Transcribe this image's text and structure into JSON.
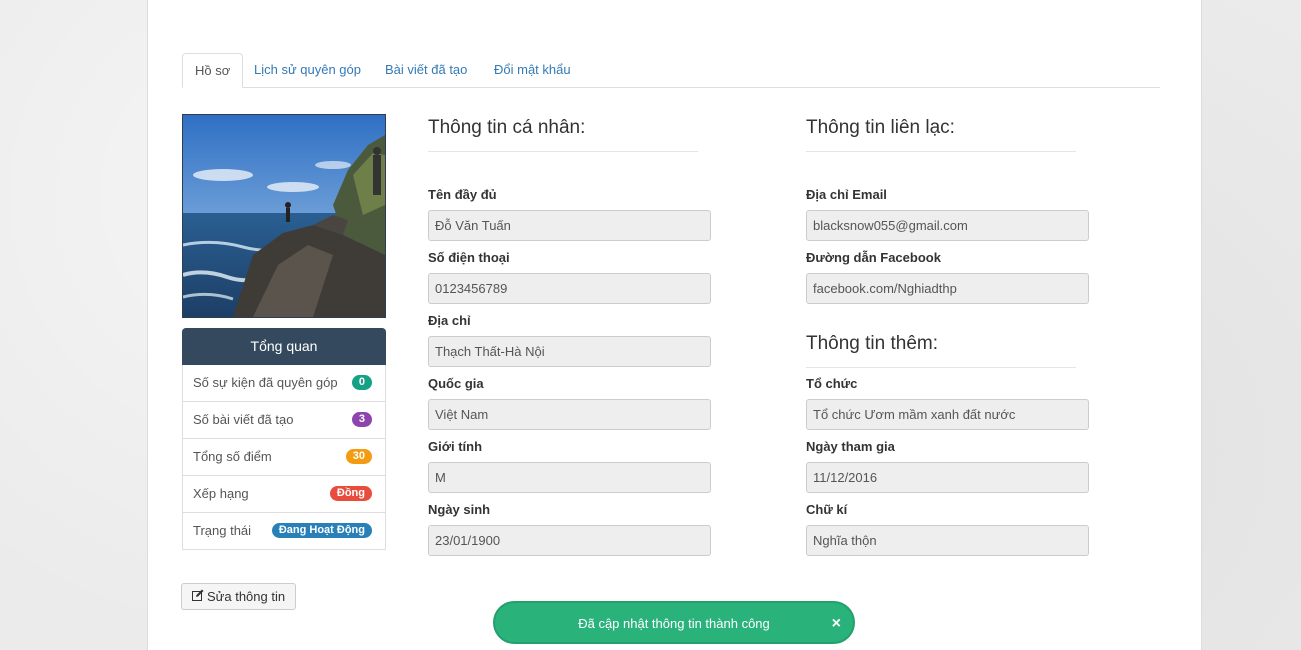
{
  "tabs": [
    "Hồ sơ",
    "Lịch sử quyên góp",
    "Bài viết đã tạo",
    "Đổi mật khẩu"
  ],
  "summary": {
    "title": "Tổng quan",
    "items": [
      {
        "label": "Số sự kiện đã quyên góp",
        "value": "0",
        "color": "#16a085"
      },
      {
        "label": "Số bài viết đã tạo",
        "value": "3",
        "color": "#8e44ad"
      },
      {
        "label": "Tổng số điểm",
        "value": "30",
        "color": "#f39c12"
      },
      {
        "label": "Xếp hạng",
        "value": "Đồng",
        "color": "#e74c3c"
      },
      {
        "label": "Trạng thái",
        "value": "Đang Hoạt Động",
        "color": "#2980b9"
      }
    ]
  },
  "personal": {
    "title": "Thông tin cá nhân:",
    "fields": [
      {
        "label": "Tên đầy đủ",
        "value": "Đỗ Văn Tuấn"
      },
      {
        "label": "Số điện thoại",
        "value": "0123456789"
      },
      {
        "label": "Địa chỉ",
        "value": "Thạch Thất-Hà Nội"
      },
      {
        "label": "Quốc gia",
        "value": "Việt Nam"
      },
      {
        "label": "Giới tính",
        "value": "M"
      },
      {
        "label": "Ngày sinh",
        "value": "23/01/1900"
      }
    ]
  },
  "contact": {
    "title": "Thông tin liên lạc:",
    "fields": [
      {
        "label": "Địa chỉ Email",
        "value": "blacksnow055@gmail.com"
      },
      {
        "label": "Đường dẫn Facebook",
        "value": "facebook.com/Nghiadthp"
      }
    ]
  },
  "extra": {
    "title": "Thông tin thêm:",
    "fields": [
      {
        "label": "Tổ chức",
        "value": "Tổ chức Ươm mầm xanh đất nước"
      },
      {
        "label": "Ngày tham gia",
        "value": "11/12/2016"
      },
      {
        "label": "Chữ kí",
        "value": "Nghĩa thộn"
      }
    ]
  },
  "edit_button": {
    "label": "Sửa thông tin",
    "icon": "edit-icon"
  },
  "toast": {
    "message": "Đã cập nhật thông tin thành công",
    "close": "×"
  }
}
